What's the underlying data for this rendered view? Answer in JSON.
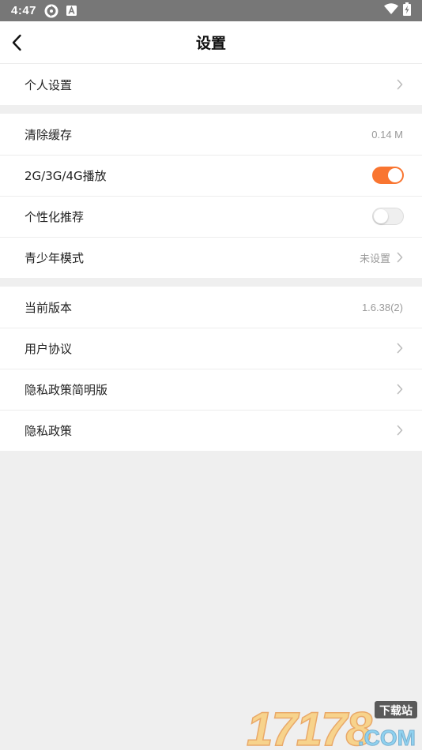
{
  "status_bar": {
    "time": "4:47",
    "icons": [
      "sync-icon",
      "a-notification-icon",
      "wifi-icon",
      "battery-charging-icon"
    ]
  },
  "header": {
    "title": "设置",
    "back_icon": "chevron-left-icon"
  },
  "groups": [
    [
      {
        "label": "个人设置",
        "value": "",
        "control": "chevron"
      }
    ],
    [
      {
        "label": "清除缓存",
        "value": "0.14 M",
        "control": "none"
      },
      {
        "label": "2G/3G/4G播放",
        "value": "",
        "control": "toggle",
        "toggle_on": true
      },
      {
        "label": "个性化推荐",
        "value": "",
        "control": "toggle",
        "toggle_on": false
      },
      {
        "label": "青少年模式",
        "value": "未设置",
        "control": "chevron"
      }
    ],
    [
      {
        "label": "当前版本",
        "value": "1.6.38(2)",
        "control": "none"
      },
      {
        "label": "用户协议",
        "value": "",
        "control": "chevron"
      },
      {
        "label": "隐私政策简明版",
        "value": "",
        "control": "chevron"
      },
      {
        "label": "隐私政策",
        "value": "",
        "control": "chevron"
      }
    ]
  ],
  "watermark": {
    "number": "17178",
    "domain": ".COM",
    "tag": "下载站"
  },
  "colors": {
    "accent": "#f97530",
    "status_bar_bg": "#777777",
    "page_bg": "#efefef",
    "value_text": "#9a9a9a",
    "chevron": "#bcbcbc"
  }
}
